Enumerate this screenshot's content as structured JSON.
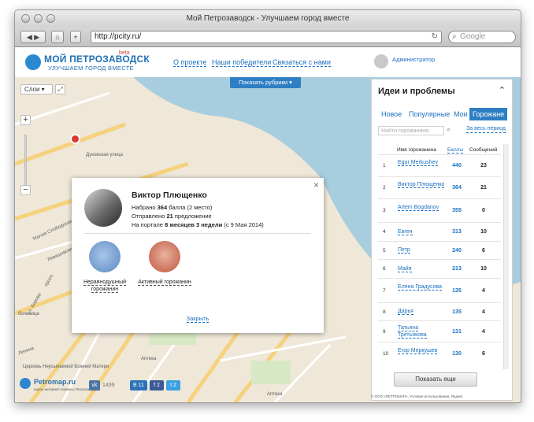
{
  "browser": {
    "window_title": "Мой Петрозаводск - Улучшаем город вместе",
    "url": "http://pcity.ru/",
    "search_placeholder": "Google"
  },
  "site": {
    "logo_title": "МОЙ ПЕТРОЗАВОДСК",
    "logo_beta": "beta",
    "logo_subtitle": "УЛУЧШАЕМ ГОРОД ВМЕСТЕ",
    "nav": [
      "О проекте",
      "Наши победители",
      "Связаться с нами"
    ],
    "admin_label": "Администратор"
  },
  "map": {
    "layers_label": "Слои",
    "zoom_in": "+",
    "zoom_out": "−",
    "rubrics_label": "Показать рубрики",
    "cluster_count": "2",
    "labels": [
      "Дуковская улица",
      "Малая Слободская улица",
      "Левашовский",
      "ул. Кирова",
      "просп.",
      "больница",
      "Ленина",
      "Церковь Неусыпаемой Божией Матери",
      "Аптека",
      "Аптека"
    ]
  },
  "profile_popup": {
    "name": "Виктор Плющенко",
    "points_prefix": "Набрано ",
    "points": "364",
    "points_suffix": " балла (2 место)",
    "sent_prefix": "Отправлено ",
    "sent": "21",
    "sent_suffix": " предложение",
    "portal_prefix": "На портале ",
    "portal": "8 месяцев 3 недели",
    "portal_suffix": " (с 9 Мая 2014)",
    "badges": [
      {
        "label": "Неравнодушный горожанин",
        "color": "#5a88c4"
      },
      {
        "label": "Активный горожанин",
        "color": "#c0533c"
      }
    ],
    "close_label": "Закрыть"
  },
  "footer": {
    "petromap": "Petromap.ru",
    "petromap_sub": "карты интернет-сервисы Петрозаводска",
    "vk_count": "1499",
    "b_count": "11",
    "f_count": "2",
    "t_count": "2",
    "copyright": "© ООО «ПЕТРОМАП», Условия использования, Яндекс"
  },
  "panel": {
    "title": "Идеи и проблемы",
    "tabs": [
      "Новое",
      "Популярные",
      "Мои",
      "Горожане"
    ],
    "active_tab": "Горожане",
    "search_placeholder": "Найти горожанина",
    "period_label": "За весь период",
    "headers": {
      "name": "Имя горожанина",
      "points": "Баллы",
      "messages": "Сообщений"
    },
    "rows": [
      {
        "num": "1",
        "name": "Egor Merkushev",
        "points": "440",
        "messages": "23"
      },
      {
        "num": "2",
        "name": "Виктор Плющенко",
        "points": "364",
        "messages": "21"
      },
      {
        "num": "3",
        "name": "Artem Bogdanov",
        "points": "355",
        "messages": "0"
      },
      {
        "num": "4",
        "name": "Евген",
        "points": "313",
        "messages": "10"
      },
      {
        "num": "5",
        "name": "Петр",
        "points": "240",
        "messages": "6"
      },
      {
        "num": "6",
        "name": "Майя",
        "points": "213",
        "messages": "10"
      },
      {
        "num": "7",
        "name": "Елена Градусова",
        "points": "135",
        "messages": "4"
      },
      {
        "num": "8",
        "name": "Дарья",
        "points": "135",
        "messages": "4"
      },
      {
        "num": "9",
        "name": "Татьяна Третьякова",
        "points": "131",
        "messages": "4"
      },
      {
        "num": "10",
        "name": "Егор Меркушев",
        "points": "130",
        "messages": "6"
      }
    ],
    "show_more": "Показать еще"
  }
}
